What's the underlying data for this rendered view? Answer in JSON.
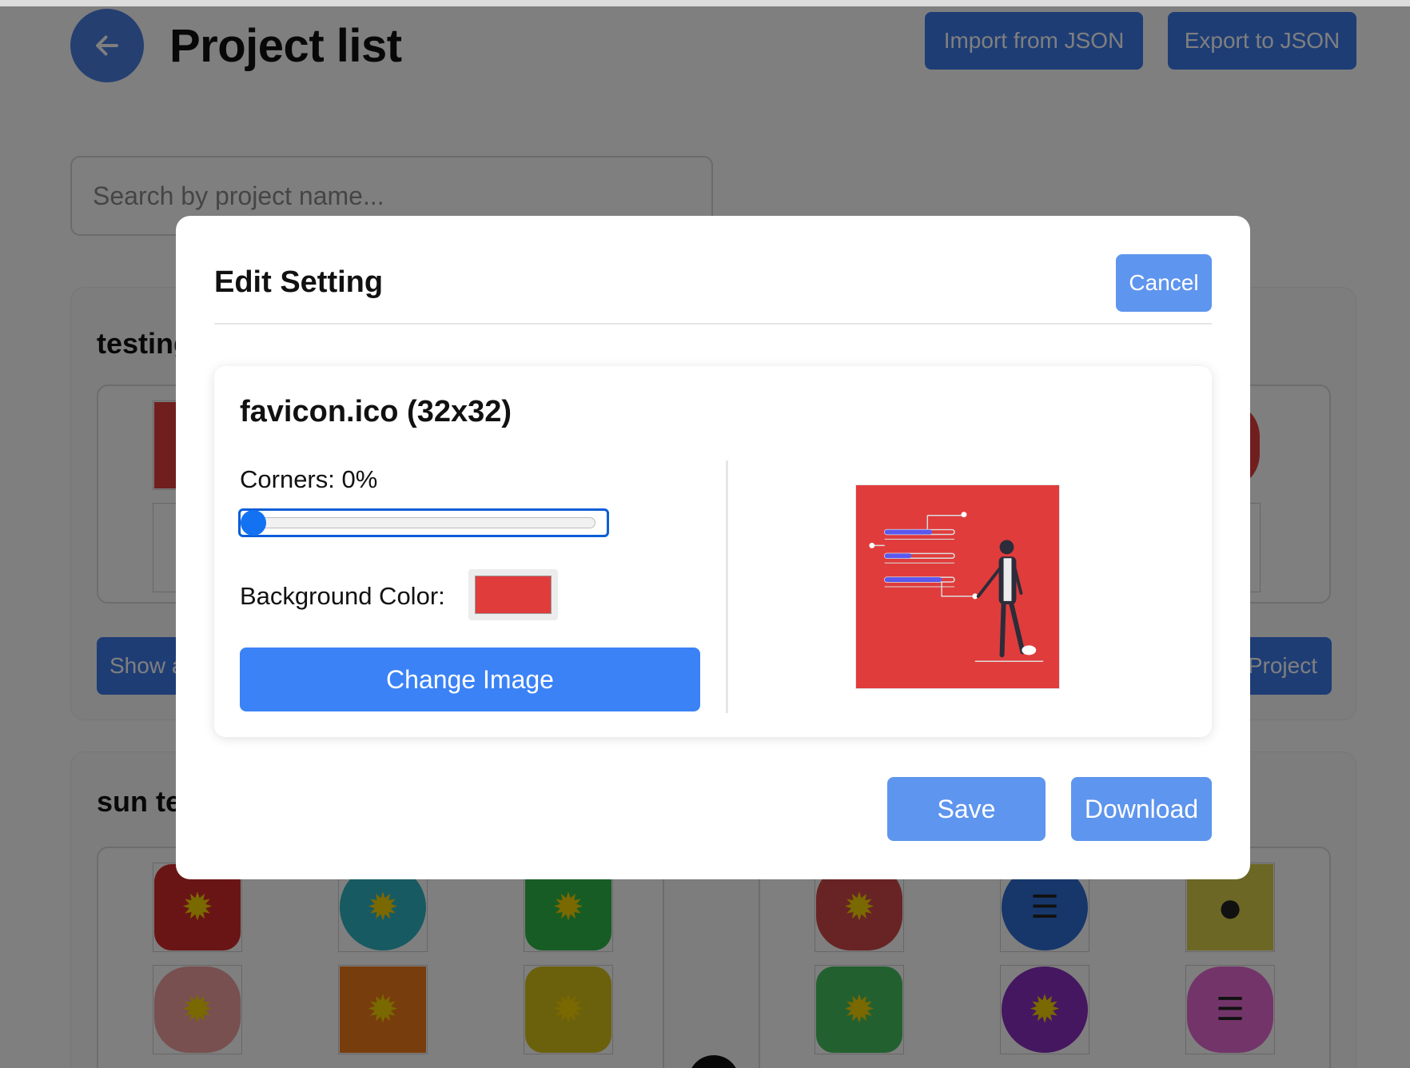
{
  "header": {
    "title": "Project list",
    "import_label": "Import from JSON",
    "export_label": "Export to JSON"
  },
  "search": {
    "placeholder": "Search by project name..."
  },
  "projects": [
    {
      "name": "testing",
      "left_button": "Show all",
      "right_button": "Project"
    },
    {
      "name": "sun test"
    }
  ],
  "modal": {
    "title": "Edit Setting",
    "cancel_label": "Cancel",
    "file_title": "favicon.ico (32x32)",
    "corners_label": "Corners: 0%",
    "corners_value": 0,
    "background_label": "Background Color:",
    "background_color": "#e03c3c",
    "change_image_label": "Change Image",
    "save_label": "Save",
    "download_label": "Download"
  },
  "colors": {
    "primary": "#3b82f6",
    "primary_light": "#5e95ee",
    "slider_focus": "#0b5ed7"
  }
}
